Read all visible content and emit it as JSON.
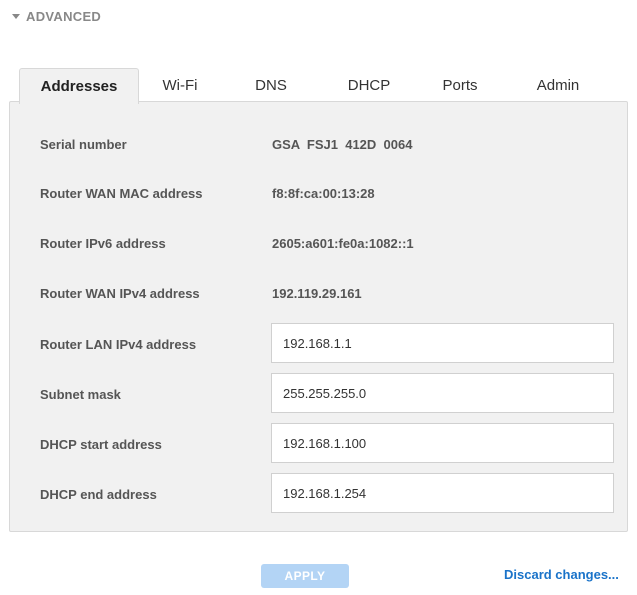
{
  "section": {
    "title": "ADVANCED",
    "icon": "caret-down-icon"
  },
  "tabs": [
    {
      "label": "Addresses",
      "active": true
    },
    {
      "label": "Wi-Fi"
    },
    {
      "label": "DNS"
    },
    {
      "label": "DHCP"
    },
    {
      "label": "Ports"
    },
    {
      "label": "Admin"
    }
  ],
  "fields": {
    "serial_number": {
      "label": "Serial number",
      "value": "GSA  FSJ1  412D  0064"
    },
    "wan_mac": {
      "label": "Router WAN MAC address",
      "value": "f8:8f:ca:00:13:28"
    },
    "ipv6": {
      "label": "Router IPv6 address",
      "value": "2605:a601:fe0a:1082::1"
    },
    "wan_ipv4": {
      "label": "Router WAN IPv4 address",
      "value": "192.119.29.161"
    },
    "lan_ipv4": {
      "label": "Router LAN IPv4 address",
      "value": "192.168.1.1"
    },
    "subnet_mask": {
      "label": "Subnet mask",
      "value": "255.255.255.0"
    },
    "dhcp_start": {
      "label": "DHCP start address",
      "value": "192.168.1.100"
    },
    "dhcp_end": {
      "label": "DHCP end address",
      "value": "192.168.1.254"
    }
  },
  "actions": {
    "apply_label": "APPLY",
    "discard_label": "Discard changes..."
  },
  "colors": {
    "panel_bg": "#f1f1f1",
    "apply_disabled": "#b3d4f5",
    "link": "#1a73c9"
  }
}
